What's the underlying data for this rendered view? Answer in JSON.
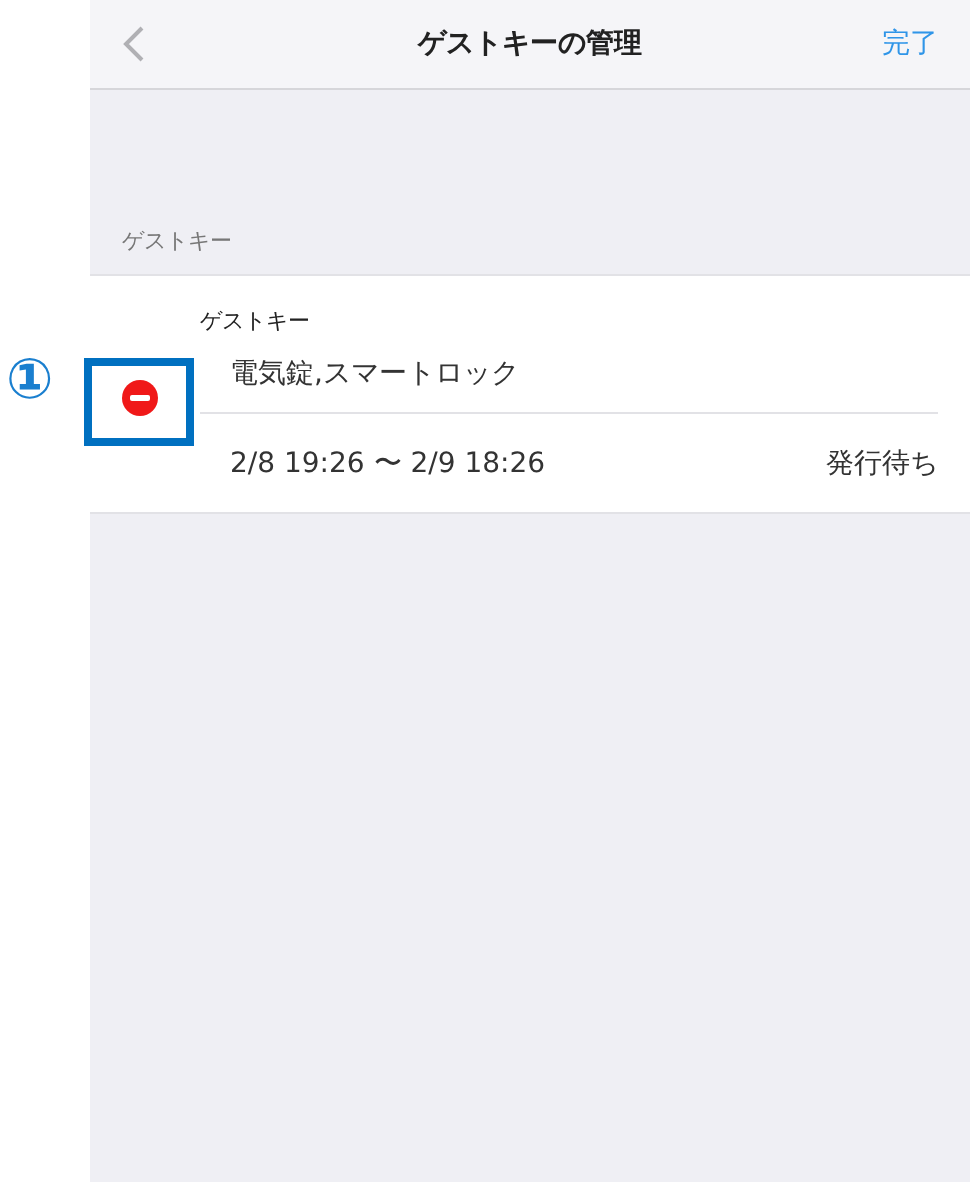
{
  "nav": {
    "title": "ゲストキーの管理",
    "done": "完了"
  },
  "section_header": "ゲストキー",
  "keys": [
    {
      "label": "ゲストキー",
      "locks": "電気錠,スマートロック",
      "period": "2/8 19:26 〜 2/9 18:26",
      "status": "発行待ち",
      "annotation": "①"
    }
  ]
}
